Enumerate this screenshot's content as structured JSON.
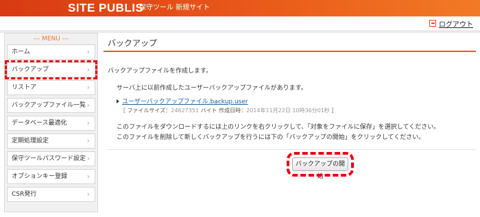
{
  "header": {
    "brand": "SITE PUBLIS",
    "tagline": "保守ツール 新規サイト",
    "logout_label": "ログアウト",
    "logout_icon": "logout-icon",
    "accent_color": "#ea5a1a"
  },
  "sidebar": {
    "title": "--- MENU ---",
    "items": [
      {
        "label": "ホーム"
      },
      {
        "label": "バックアップ"
      },
      {
        "label": "リストア"
      },
      {
        "label": "バックアップファイル一覧"
      },
      {
        "label": "データベース最適化"
      },
      {
        "label": "定期処理設定"
      },
      {
        "label": "保守ツールパスワード設定"
      },
      {
        "label": "オプションキー登録"
      },
      {
        "label": "CSR発行"
      }
    ],
    "chevron": "›"
  },
  "main": {
    "title": "バックアップ",
    "intro": "バックアップファイルを作成します。",
    "notice": "サーバ上に以前作成したユーザーバックアップファイルがあります。",
    "file": {
      "name": "ユーザーバックアップファイル.backup.user",
      "info_prefix": "［ ファイルサイズ：",
      "size": "24627351",
      "info_mid": " バイト 作成日時：",
      "created": "2014年11月22日 10時36分01秒",
      "info_suffix": " ］"
    },
    "instruction1": "このファイルをダウンロードするには上のリンクを右クリックして、「対象をファイルに保存」を選択してください。",
    "instruction2": "このファイルを削除して新しくバックアップを行うには下の「バックアップの開始」をクリックしてください。",
    "start_button": "バックアップの開始"
  }
}
